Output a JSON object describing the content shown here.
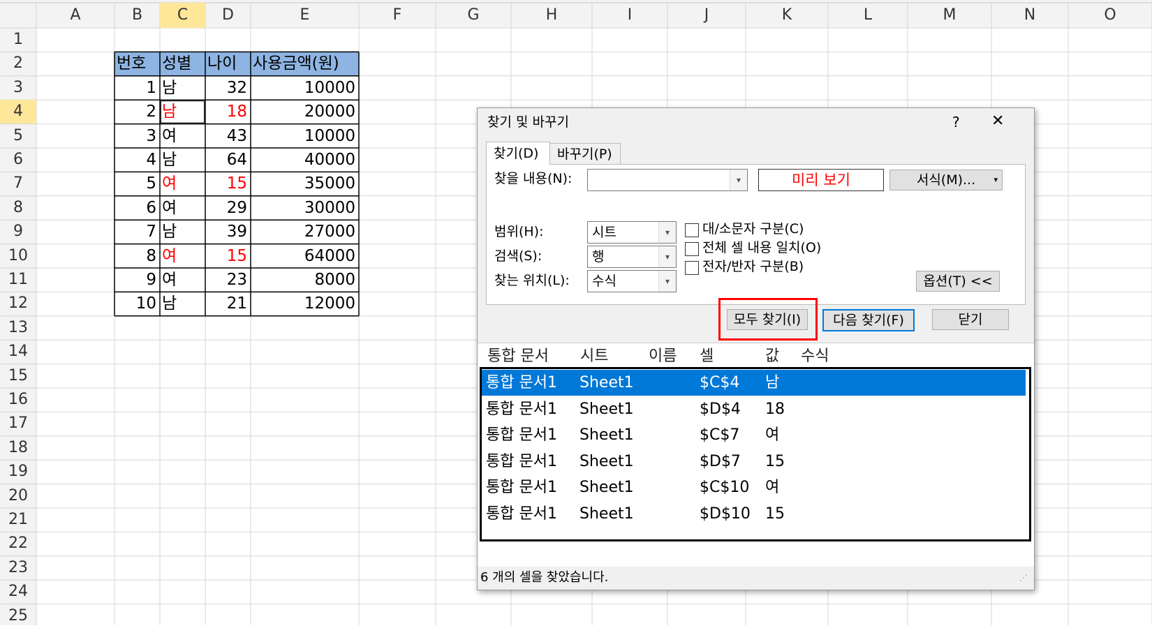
{
  "columns": [
    "A",
    "B",
    "C",
    "D",
    "E",
    "F",
    "G",
    "H",
    "I",
    "J",
    "K",
    "L",
    "M",
    "N",
    "O"
  ],
  "rows": [
    "1",
    "2",
    "3",
    "4",
    "5",
    "6",
    "7",
    "8",
    "9",
    "10",
    "11",
    "12",
    "13",
    "14",
    "15",
    "16",
    "17",
    "18",
    "19",
    "20",
    "21",
    "22",
    "23",
    "24",
    "25"
  ],
  "table": {
    "headers": [
      "번호",
      "성별",
      "나이",
      "사용금액(원)"
    ],
    "rows": [
      {
        "no": "1",
        "gender": "남",
        "age": "32",
        "amount": "10000",
        "hl": false
      },
      {
        "no": "2",
        "gender": "남",
        "age": "18",
        "amount": "20000",
        "hl": true
      },
      {
        "no": "3",
        "gender": "여",
        "age": "43",
        "amount": "10000",
        "hl": false
      },
      {
        "no": "4",
        "gender": "남",
        "age": "64",
        "amount": "40000",
        "hl": false
      },
      {
        "no": "5",
        "gender": "여",
        "age": "15",
        "amount": "35000",
        "hl": true
      },
      {
        "no": "6",
        "gender": "여",
        "age": "29",
        "amount": "30000",
        "hl": false
      },
      {
        "no": "7",
        "gender": "남",
        "age": "39",
        "amount": "27000",
        "hl": false
      },
      {
        "no": "8",
        "gender": "여",
        "age": "15",
        "amount": "64000",
        "hl": true
      },
      {
        "no": "9",
        "gender": "여",
        "age": "23",
        "amount": "8000",
        "hl": false
      },
      {
        "no": "10",
        "gender": "남",
        "age": "21",
        "amount": "12000",
        "hl": false
      }
    ]
  },
  "dialog": {
    "title": "찾기 및 바꾸기",
    "help": "?",
    "close": "✕",
    "tab_find": "찾기(D)",
    "tab_replace": "바꾸기(P)",
    "find_what_label": "찾을 내용(N):",
    "find_what_value": "",
    "preview_label": "미리 보기",
    "format_button": "서식(M)...",
    "within_label": "범위(H):",
    "within_value": "시트",
    "search_label": "검색(S):",
    "search_value": "행",
    "look_in_label": "찾는 위치(L):",
    "look_in_value": "수식",
    "match_case": "대/소문자 구분(C)",
    "match_entire": "전체 셀 내용 일치(O)",
    "match_byte": "전자/반자 구분(B)",
    "options_button": "옵션(T) <<",
    "find_all": "모두 찾기(I)",
    "find_next": "다음 찾기(F)",
    "close_button": "닫기",
    "results_headers": [
      "통합 문서",
      "시트",
      "이름",
      "셀",
      "값",
      "수식"
    ],
    "results": [
      {
        "book": "통합 문서1",
        "sheet": "Sheet1",
        "name": "",
        "cell": "$C$4",
        "value": "남"
      },
      {
        "book": "통합 문서1",
        "sheet": "Sheet1",
        "name": "",
        "cell": "$D$4",
        "value": "18"
      },
      {
        "book": "통합 문서1",
        "sheet": "Sheet1",
        "name": "",
        "cell": "$C$7",
        "value": "여"
      },
      {
        "book": "통합 문서1",
        "sheet": "Sheet1",
        "name": "",
        "cell": "$D$7",
        "value": "15"
      },
      {
        "book": "통합 문서1",
        "sheet": "Sheet1",
        "name": "",
        "cell": "$C$10",
        "value": "여"
      },
      {
        "book": "통합 문서1",
        "sheet": "Sheet1",
        "name": "",
        "cell": "$D$10",
        "value": "15"
      }
    ],
    "status": "6 개의 셀을 찾았습니다."
  },
  "colors": {
    "header_fill": "#8db4e2",
    "highlight": "#ff0000",
    "selection": "#0078d7",
    "callout": "#ff0000"
  }
}
